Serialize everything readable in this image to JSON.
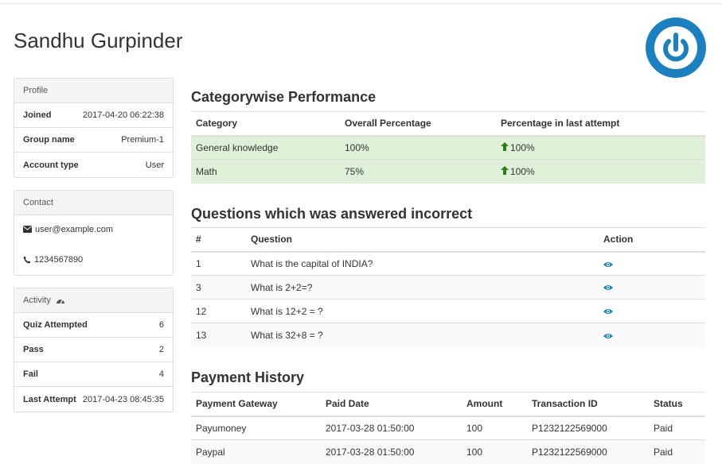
{
  "user": {
    "name": "Sandhu Gurpinder"
  },
  "profile": {
    "heading": "Profile",
    "rows": [
      {
        "label": "Joined",
        "value": "2017-04-20 06:22:38"
      },
      {
        "label": "Group name",
        "value": "Premium-1"
      },
      {
        "label": "Account type",
        "value": "User"
      }
    ]
  },
  "contact": {
    "heading": "Contact",
    "email": "user@example.com",
    "phone": "1234567890"
  },
  "activity": {
    "heading": "Activity",
    "rows": [
      {
        "label": "Quiz Attempted",
        "value": "6"
      },
      {
        "label": "Pass",
        "value": "2"
      },
      {
        "label": "Fail",
        "value": "4"
      },
      {
        "label": "Last Attempt",
        "value": "2017-04-23 08:45:35"
      }
    ]
  },
  "performance": {
    "title": "Categorywise Performance",
    "headers": [
      "Category",
      "Overall Percentage",
      "Percentage in last attempt"
    ],
    "rows": [
      {
        "category": "General knowledge",
        "overall": "100%",
        "last": "100%"
      },
      {
        "category": "Math",
        "overall": "75%",
        "last": "100%"
      }
    ]
  },
  "incorrect": {
    "title": "Questions which was answered incorrect",
    "headers": [
      "#",
      "Question",
      "Action"
    ],
    "rows": [
      {
        "num": "1",
        "question": "What is the capital of INDIA?"
      },
      {
        "num": "3",
        "question": "What is 2+2=?"
      },
      {
        "num": "12",
        "question": "What is 12+2 = ?"
      },
      {
        "num": "13",
        "question": "What is 32+8 = ?"
      }
    ]
  },
  "payments": {
    "title": "Payment History",
    "headers": [
      "Payment Gateway",
      "Paid Date",
      "Amount",
      "Transaction ID",
      "Status"
    ],
    "rows": [
      {
        "gateway": "Payumoney",
        "date": "2017-03-28 01:50:00",
        "amount": "100",
        "txn": "P1232122569000",
        "status": "Paid"
      },
      {
        "gateway": "Paypal",
        "date": "2017-03-28 01:50:00",
        "amount": "100",
        "txn": "P1232122569000",
        "status": "Paid"
      }
    ]
  },
  "colors": {
    "success_bg": "#dff0d8",
    "accent": "#1b7fc0",
    "up_arrow": "#3c9b23"
  },
  "icons": {
    "logo": "power-logo-icon",
    "email": "envelope-icon",
    "phone": "phone-icon",
    "activity": "dashboard-icon",
    "up": "arrow-up-icon",
    "view": "eye-icon"
  }
}
